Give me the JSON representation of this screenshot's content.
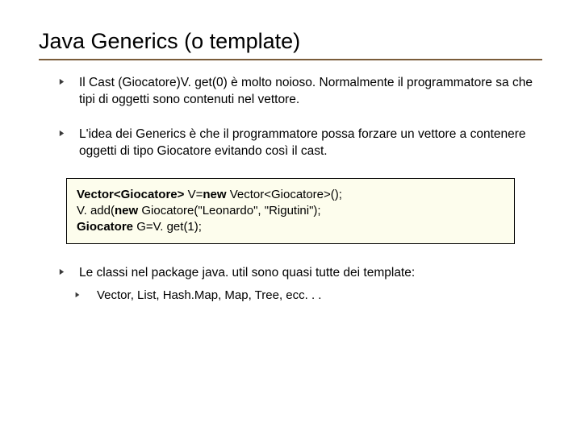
{
  "title": "Java Generics (o template)",
  "bullets": [
    "Il Cast (Giocatore)V. get(0) è molto noioso. Normalmente il programmatore sa che tipi di oggetti sono contenuti nel vettore.",
    "L'idea dei Generics è che il programmatore possa forzare un vettore a contenere oggetti di tipo Giocatore evitando così il cast.",
    "Le classi nel package java. util sono quasi tutte dei template:"
  ],
  "code": {
    "l1_a": "Vector<Giocatore>",
    "l1_b": " V=",
    "l1_c": "new",
    "l1_d": " Vector<Giocatore>();",
    "l2_a": "V. add(",
    "l2_b": "new",
    "l2_c": " Giocatore(\"Leonardo\", \"Rigutini\");",
    "l3_a": "Giocatore",
    "l3_b": " G=V. get(1);"
  },
  "sub": "Vector, List, Hash.Map, Map, Tree, ecc. . ."
}
